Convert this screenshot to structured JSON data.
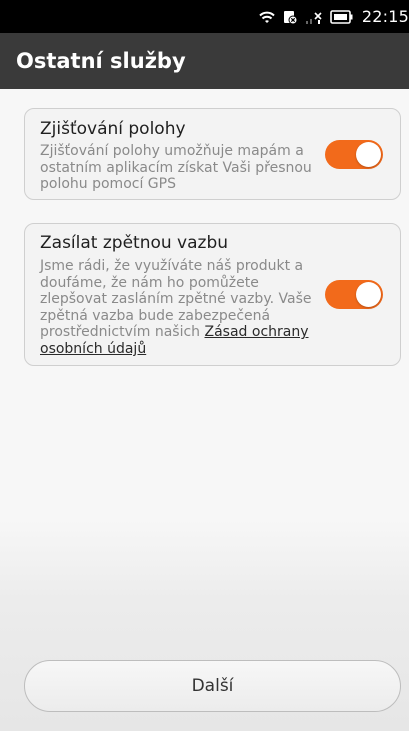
{
  "status_bar": {
    "time": "22:15",
    "icons": [
      "wifi-icon",
      "no-sim-icon",
      "signal-off-icon",
      "battery-icon"
    ]
  },
  "header": {
    "title": "Ostatní služby"
  },
  "settings": [
    {
      "title": "Zjišťování polohy",
      "description": "Zjišťování polohy umožňuje mapám a ostatním aplikacím získat Vaši přesnou polohu pomocí GPS",
      "enabled": true
    },
    {
      "title": "Zasílat zpětnou vazbu",
      "description_prefix": "Jsme rádi, že využíváte náš produkt a doufáme, že nám ho pomůžete zlepšovat zasláním zpětné vazby. Vaše zpětná vazba bude zabezpečená prostřednictvím našich ",
      "link_text": "Zásad ochrany osobních údajů",
      "enabled": true
    }
  ],
  "footer": {
    "next_label": "Další"
  },
  "colors": {
    "accent": "#f26a1b",
    "title_bar": "#3a3a3a",
    "status_bar": "#000000"
  }
}
